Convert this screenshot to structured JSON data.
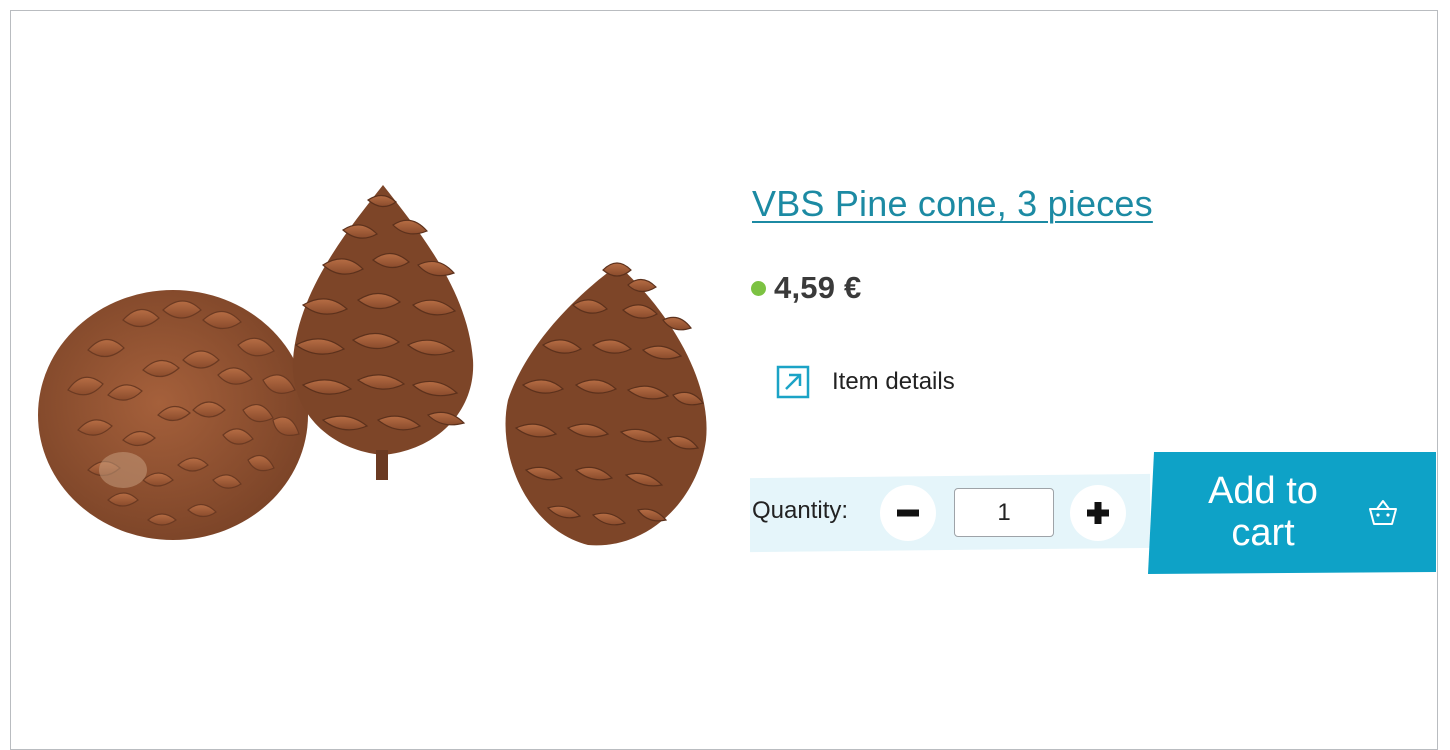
{
  "product": {
    "title": "VBS Pine cone, 3 pieces",
    "price": "4,59 €",
    "image_alt": "pine-cones-product-image"
  },
  "details": {
    "label": "Item details",
    "icon": "external-arrow-icon"
  },
  "quantity": {
    "label": "Quantity:",
    "value": "1",
    "minus_icon": "minus-icon",
    "plus_icon": "plus-icon"
  },
  "cart": {
    "label": "Add to cart",
    "icon": "basket-icon"
  },
  "colors": {
    "accent": "#1c8aa3",
    "cart_button": "#0ea2c7",
    "stock": "#7cc242",
    "qty_band": "#e5f5fa"
  }
}
